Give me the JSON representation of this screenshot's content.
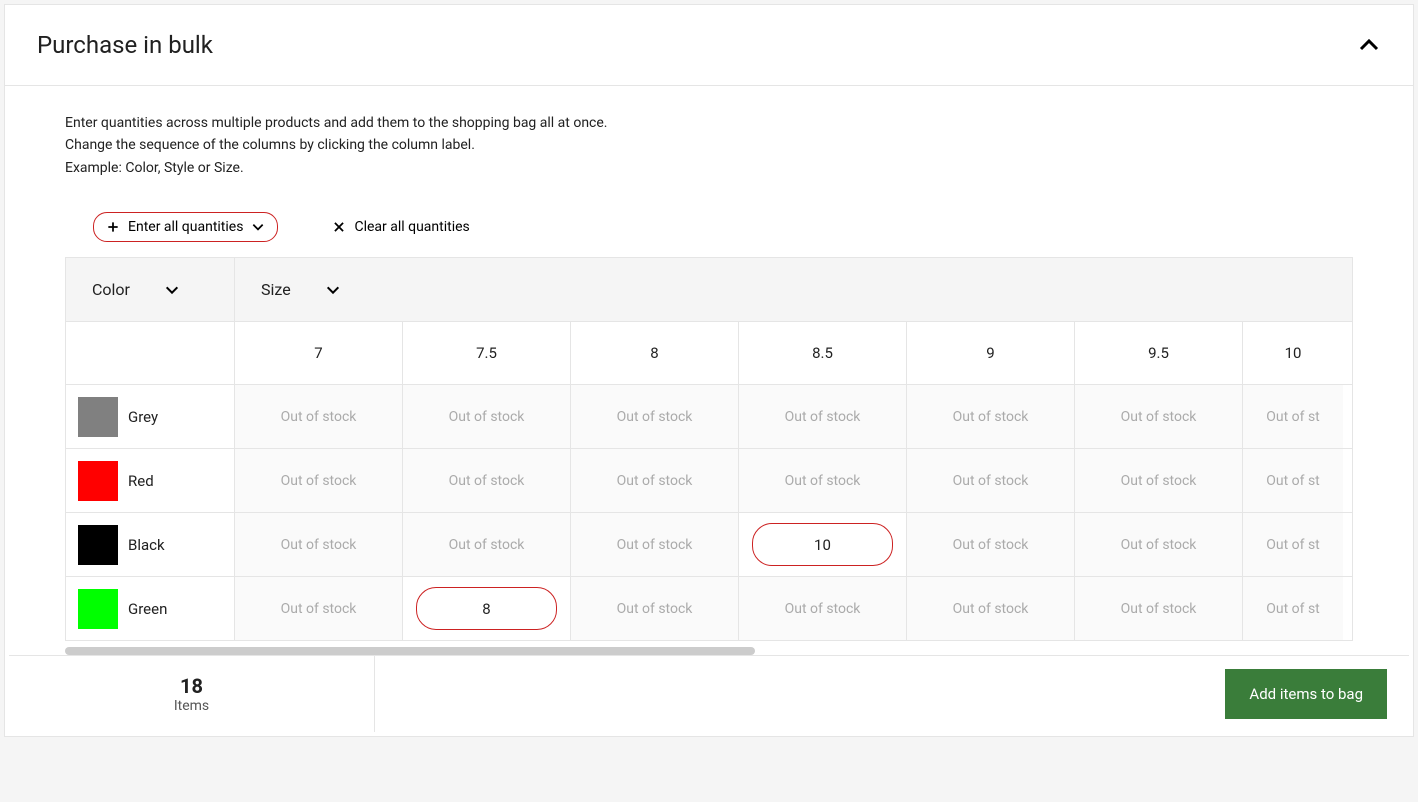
{
  "header": {
    "title": "Purchase in bulk"
  },
  "description": {
    "line1": "Enter quantities across multiple products and add them to the shopping bag all at once.",
    "line2": "Change the sequence of the columns by clicking the column label.",
    "line3": "Example: Color, Style or Size."
  },
  "actions": {
    "enter_all": "Enter all quantities",
    "clear_all": "Clear all quantities"
  },
  "table": {
    "column_attr1": "Color",
    "column_attr2": "Size",
    "sizes": [
      "7",
      "7.5",
      "8",
      "8.5",
      "9",
      "9.5",
      "10"
    ],
    "out_of_stock_label": "Out of stock",
    "out_of_stock_label_cut": "Out of st",
    "rows": [
      {
        "label": "Grey",
        "swatch": "#808080",
        "cells": [
          null,
          null,
          null,
          null,
          null,
          null,
          null
        ]
      },
      {
        "label": "Red",
        "swatch": "#ff0000",
        "cells": [
          null,
          null,
          null,
          null,
          null,
          null,
          null
        ]
      },
      {
        "label": "Black",
        "swatch": "#000000",
        "cells": [
          null,
          null,
          null,
          "10",
          null,
          null,
          null
        ]
      },
      {
        "label": "Green",
        "swatch": "#00ff00",
        "cells": [
          null,
          "8",
          null,
          null,
          null,
          null,
          null
        ]
      }
    ]
  },
  "footer": {
    "count": "18",
    "count_label": "Items",
    "add_button": "Add items to bag"
  }
}
